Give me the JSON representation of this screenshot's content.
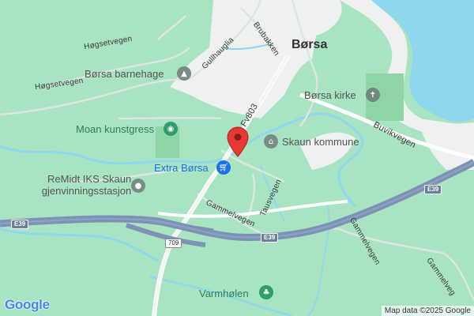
{
  "labels": {
    "city": "Børsa",
    "church": "Børsa kirke",
    "kindergarten": "Børsa barnehage",
    "municipality": "Skaun kommune",
    "turf": "Moan kunstgress",
    "shop": "Extra Børsa",
    "recycle_line1": "ReMidt IKS Skaun",
    "recycle_line2": "gjenvinningsstasjon",
    "varmholen": "Varmhølen"
  },
  "roads": {
    "hogsetvegen_top": "Høgsetvegen",
    "hogsetvegen_left": "Høgsetvegen",
    "gullhauglia": "Gullhauglia",
    "brubakken": "Brubakken",
    "fv803": "Fv803",
    "buvikvegen": "Buvikvegen",
    "tausvegen": "Tausvegen",
    "gammelvegen_left": "Gammelvegen",
    "gammelvegen_mid": "Gammelvegen",
    "gammelvegen_right": "Gammelveg"
  },
  "shields": {
    "e39_left": "E39",
    "e39_mid": "E39",
    "e39_right": "E39",
    "r709": "709"
  },
  "branding": {
    "logo": "Google",
    "attribution": "Map data ©2025 Google"
  },
  "icons": {
    "church": "church-cross-icon",
    "kindergarten": "school-cap-icon",
    "municipality": "town-hall-icon",
    "turf": "sports-field-icon",
    "shop": "shopping-cart-icon",
    "recycle": "info-dot-icon",
    "varmholen": "park-icon",
    "pin": "red-location-pin"
  },
  "colors": {
    "land": "#a8e3c2",
    "water": "#8fd7ec",
    "urban": "#eef1ef",
    "highway": "#7d93b5",
    "pin": "#e53935"
  }
}
